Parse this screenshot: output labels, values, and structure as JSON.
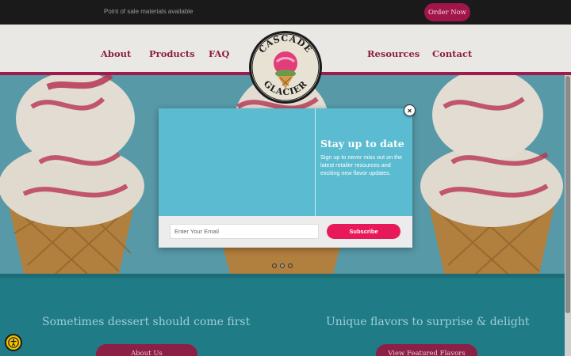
{
  "topbar": {
    "text": "Point of sale materials available",
    "order_label": "Order Now"
  },
  "nav": {
    "items": [
      {
        "label": "About"
      },
      {
        "label": "Products"
      },
      {
        "label": "FAQ"
      },
      {
        "label": "Resources"
      },
      {
        "label": "Contact"
      }
    ],
    "logo": {
      "top_text": "CASCADE",
      "bottom_text": "GLACIER"
    }
  },
  "hero": {
    "slides_total": 3,
    "active_slide": 2
  },
  "popup": {
    "title": "Stay up to date",
    "body": "Sign up to never miss out on the latest retailer resources and exciting new flavor updates.",
    "email_placeholder": "Enter Your Email",
    "subscribe_label": "Subscribe",
    "close_label": "×"
  },
  "lower": {
    "left_heading": "Sometimes dessert should come first",
    "left_button": "About Us",
    "right_heading": "Unique flavors to surprise & delight",
    "right_button": "View Featured Flavors"
  },
  "colors": {
    "brand_magenta": "#8c1f44",
    "teal": "#1f7b86",
    "popup_blue": "#5bbbd0",
    "subscribe_pink": "#e8195a"
  }
}
